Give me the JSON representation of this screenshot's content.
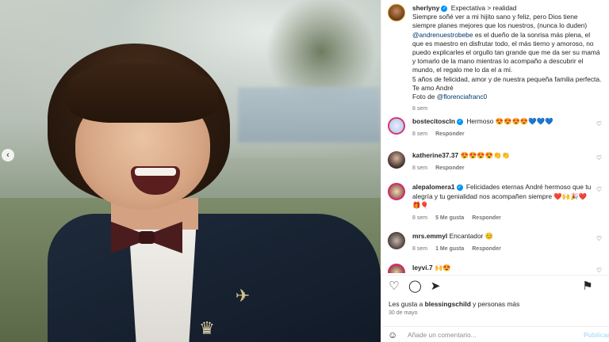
{
  "post": {
    "username": "sherlyny",
    "title": "Expectativa > realidad",
    "caption_lines": [
      "Siempre soñé ver a mi hijito sano y feliz, pero Dios tiene siempre planes mejores que los nuestros, (nunca lo duden)",
      "@andrenuestrobebe",
      " es el dueño de la sonrisa más plena, el que es maestro en disfrutar todo, el más tierno y amoroso, no puedo explicarles el orgullo tan grande que me da ser su mamá y tomarlo de la mano mientras lo acompaño a descubrir el mundo, el regalo me lo da el a mi.",
      "5 años de felicidad, amor y de nuestra pequeña familia perfecta.",
      "Te amo André",
      "Foto de ",
      "@florenciafranc0"
    ],
    "time": "8 sem"
  },
  "comments": [
    {
      "username": "bostecitoscln",
      "verified": true,
      "text": "Hermoso 😍😍😍😍💙💙💙",
      "time": "8 sem",
      "reply": "Responder",
      "likes": ""
    },
    {
      "username": "katherine37.37",
      "verified": false,
      "text": "😍😍😍😍👏👏",
      "time": "8 sem",
      "reply": "Responder",
      "likes": ""
    },
    {
      "username": "alepalomera1",
      "verified": true,
      "text": "Felicidades eternas André hermoso que tu alegría y tu genialidad nos acompañen siempre ❤️🙌🎉❤️🎁🎈",
      "time": "8 sem",
      "reply": "Responder",
      "likes": "5 Me gusta"
    },
    {
      "username": "mrs.emmyl",
      "verified": false,
      "text": "Encantador 😊",
      "time": "8 sem",
      "reply": "Responder",
      "likes": "1 Me gusta"
    },
    {
      "username": "leyvi.7",
      "verified": false,
      "text": "🙌😍",
      "time": "",
      "reply": "",
      "likes": ""
    }
  ],
  "footer": {
    "likes_prefix": "Les gusta a ",
    "likes_user": "blessingschild",
    "likes_suffix": " y personas más",
    "date": "30 de mayo",
    "add_comment_placeholder": "Añade un comentario...",
    "publish": "Publicar"
  },
  "icons": {
    "like": "heart-icon",
    "comment": "comment-icon",
    "share": "share-icon",
    "save": "bookmark-icon",
    "emoji": "emoji-icon",
    "nav": "chevron-left-icon"
  },
  "colors": {
    "link": "#00376b",
    "verified": "#0095f6",
    "publish": "#b2dffc"
  }
}
